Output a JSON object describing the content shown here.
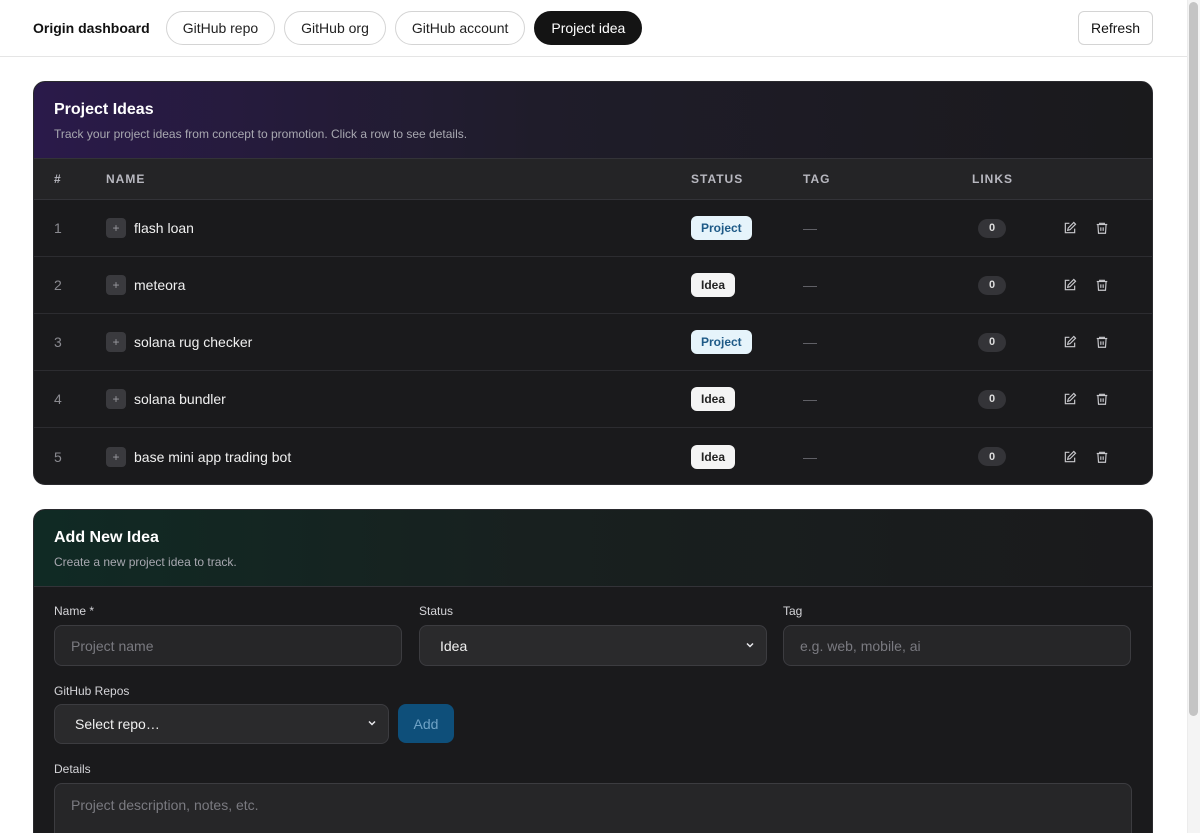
{
  "nav": {
    "brand": "Origin dashboard",
    "tabs": [
      {
        "label": "GitHub repo",
        "active": false
      },
      {
        "label": "GitHub org",
        "active": false
      },
      {
        "label": "GitHub account",
        "active": false
      },
      {
        "label": "Project idea",
        "active": true
      }
    ],
    "refresh_label": "Refresh"
  },
  "ideas": {
    "title": "Project Ideas",
    "subtitle": "Track your project ideas from concept to promotion. Click a row to see details.",
    "columns": {
      "num": "#",
      "name": "NAME",
      "status": "STATUS",
      "tag": "TAG",
      "links": "LINKS"
    },
    "rows": [
      {
        "num": "1",
        "name": "flash loan",
        "status": "Project",
        "tag": "—",
        "links": "0"
      },
      {
        "num": "2",
        "name": "meteora",
        "status": "Idea",
        "tag": "—",
        "links": "0"
      },
      {
        "num": "3",
        "name": "solana rug checker",
        "status": "Project",
        "tag": "—",
        "links": "0"
      },
      {
        "num": "4",
        "name": "solana bundler",
        "status": "Idea",
        "tag": "—",
        "links": "0"
      },
      {
        "num": "5",
        "name": "base mini app trading bot",
        "status": "Idea",
        "tag": "—",
        "links": "0"
      }
    ]
  },
  "new_idea": {
    "title": "Add New Idea",
    "subtitle": "Create a new project idea to track.",
    "name_label": "Name *",
    "name_placeholder": "Project name",
    "status_label": "Status",
    "status_value": "Idea",
    "tag_label": "Tag",
    "tag_placeholder": "e.g. web, mobile, ai",
    "repos_label": "GitHub Repos",
    "repos_value": "Select repo…",
    "add_label": "Add",
    "details_label": "Details",
    "details_placeholder": "Project description, notes, etc."
  },
  "colors": {
    "project_badge_bg": "#e6f4fb",
    "project_badge_text": "#1e5a87",
    "active_tab": "#141414",
    "add_button": "#0e4f7a"
  }
}
